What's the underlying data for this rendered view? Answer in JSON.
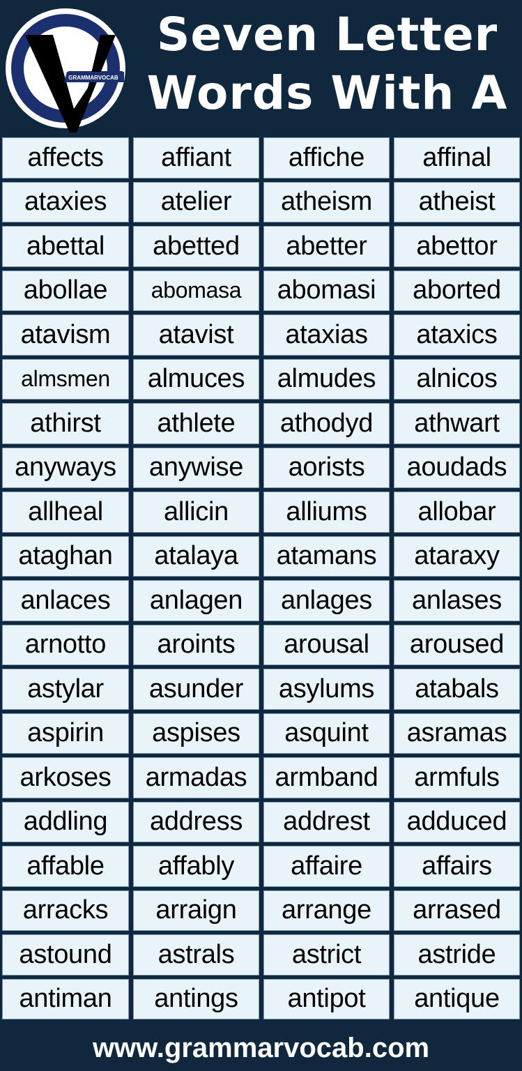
{
  "logo": {
    "icon": "grammarvocab-gv-logo",
    "text": "GRAMMARVOCAB",
    "colors": {
      "ring": "#1c2f6e",
      "inner": "#ffffff",
      "letter": "#000000"
    }
  },
  "title": {
    "line1": "Seven Letter",
    "line2": "Words With A"
  },
  "colors": {
    "background": "#10283d",
    "cell": "#e8f4fa",
    "text": "#000000",
    "title": "#ffffff"
  },
  "words": [
    [
      "affects",
      "affiant",
      "affiche",
      "affinal"
    ],
    [
      "ataxies",
      "atelier",
      "atheism",
      "atheist"
    ],
    [
      "abettal",
      "abetted",
      "abetter",
      "abettor"
    ],
    [
      "abollae",
      "abomasa",
      "abomasi",
      "aborted"
    ],
    [
      "atavism",
      "atavist",
      "ataxias",
      "ataxics"
    ],
    [
      "almsmen",
      "almuces",
      "almudes",
      "alnicos"
    ],
    [
      "athirst",
      "athlete",
      "athodyd",
      "athwart"
    ],
    [
      "anyways",
      "anywise",
      "aorists",
      "aoudads"
    ],
    [
      "allheal",
      "allicin",
      "alliums",
      "allobar"
    ],
    [
      "ataghan",
      "atalaya",
      "atamans",
      "ataraxy"
    ],
    [
      "anlaces",
      "anlagen",
      "anlages",
      "anlases"
    ],
    [
      "arnotto",
      "aroints",
      "arousal",
      "aroused"
    ],
    [
      "astylar",
      "asunder",
      "asylums",
      "atabals"
    ],
    [
      "aspirin",
      "aspises",
      "asquint",
      "asramas"
    ],
    [
      "arkoses",
      "armadas",
      "armband",
      "armfuls"
    ],
    [
      "addling",
      "address",
      "addrest",
      "adduced"
    ],
    [
      "affable",
      "affably",
      "affaire",
      "affairs"
    ],
    [
      "arracks",
      "arraign",
      "arrange",
      "arrased"
    ],
    [
      "astound",
      "astrals",
      "astrict",
      "astride"
    ],
    [
      "antiman",
      "antings",
      "antipot",
      "antique"
    ]
  ],
  "footer": {
    "url": "www.grammarvocab.com"
  }
}
